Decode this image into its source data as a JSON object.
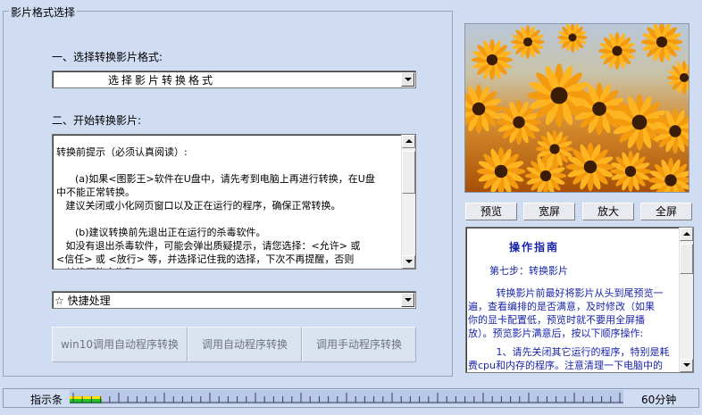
{
  "group": {
    "title": "影片格式选择"
  },
  "step1": {
    "label": "一、选择转换影片格式:"
  },
  "format_select": {
    "value": "选择影片转换格式"
  },
  "step2": {
    "label": "二、开始转换影片:"
  },
  "tips": {
    "lines": [
      "转换前提示（必须认真阅读）:",
      "",
      "      (a)如果<图影王>软件在U盘中，请先考到电脑上再进行转换，在U盘",
      "中不能正常转换。",
      "   建议关闭或小化网页窗口以及正在运行的程序，确保正常转换。",
      "",
      "      (b)建议转换前先退出正在运行的杀毒软件。",
      "   如没有退出杀毒软件，可能会弹出质疑提示，请您选择：<允许> 或",
      "<信任> 或 <放行> 等，并选择记住我的选择，下次不再提醒，否则",
      "，转换可能会失败。"
    ]
  },
  "quick_select": {
    "value": "☆ 快捷处理"
  },
  "buttons": {
    "win10_auto": "win10调用自动程序转换",
    "auto": "调用自动程序转换",
    "manual": "调用手动程序转换",
    "preview": "预览",
    "widescreen": "宽屏",
    "zoom": "放大",
    "fullscreen": "全屏"
  },
  "guide": {
    "title": "操作指南",
    "step": "第七步：转换影片",
    "para1": [
      "         转换影片前最好将影片从头到尾预览一",
      "遍，查看编排的是否满意，及时修改（如果",
      "你的显卡配置低，预览时就不要用全屏播",
      "放）。预览影片满意后，按以下顺序操作:"
    ],
    "para2": [
      "         1、请先关闭其它运行的程序，特别是耗",
      "费cpu和内存的程序。注意清理一下电脑中的"
    ]
  },
  "statusbar": {
    "label": "指示条",
    "time": "60分钟",
    "progress": 0.058
  },
  "colors": {
    "background": "#cfdcf2",
    "guide_text": "#1a26a8",
    "progress": "#1fc81f"
  }
}
